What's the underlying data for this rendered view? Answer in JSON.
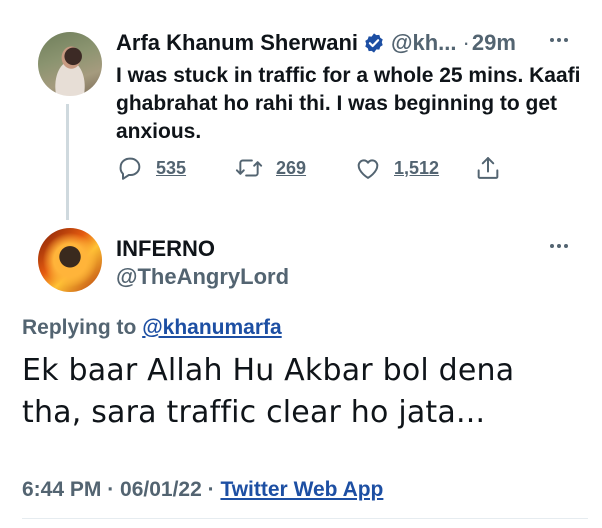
{
  "original_tweet": {
    "author_name": "Arfa Khanum Sherwani",
    "handle": "@kh...",
    "separator": "·",
    "time": "29m",
    "text": "I was stuck in traffic for a whole 25 mins. Kaafi ghabrahat ho rahi thi. I was beginning to get anxious.",
    "actions": [
      {
        "icon": "reply-icon",
        "count": "535"
      },
      {
        "icon": "retweet-icon",
        "count": "269"
      },
      {
        "icon": "like-icon",
        "count": "1,512"
      },
      {
        "icon": "share-icon",
        "count": ""
      }
    ],
    "verified_color": "#1d4fa3"
  },
  "reply_tweet": {
    "author_name": "INFERNO",
    "handle": "@TheAngryLord",
    "replying_prefix": "Replying to",
    "replying_to": "@khanumarfa",
    "text": "Ek baar Allah Hu Akbar bol dena tha, sara traffic clear ho jata...",
    "meta_time": "6:44 PM · 06/01/22 ·",
    "meta_app": "Twitter Web App"
  },
  "colors": {
    "text": "#0f1419",
    "muted": "#536471",
    "link": "#1d4fa3"
  }
}
